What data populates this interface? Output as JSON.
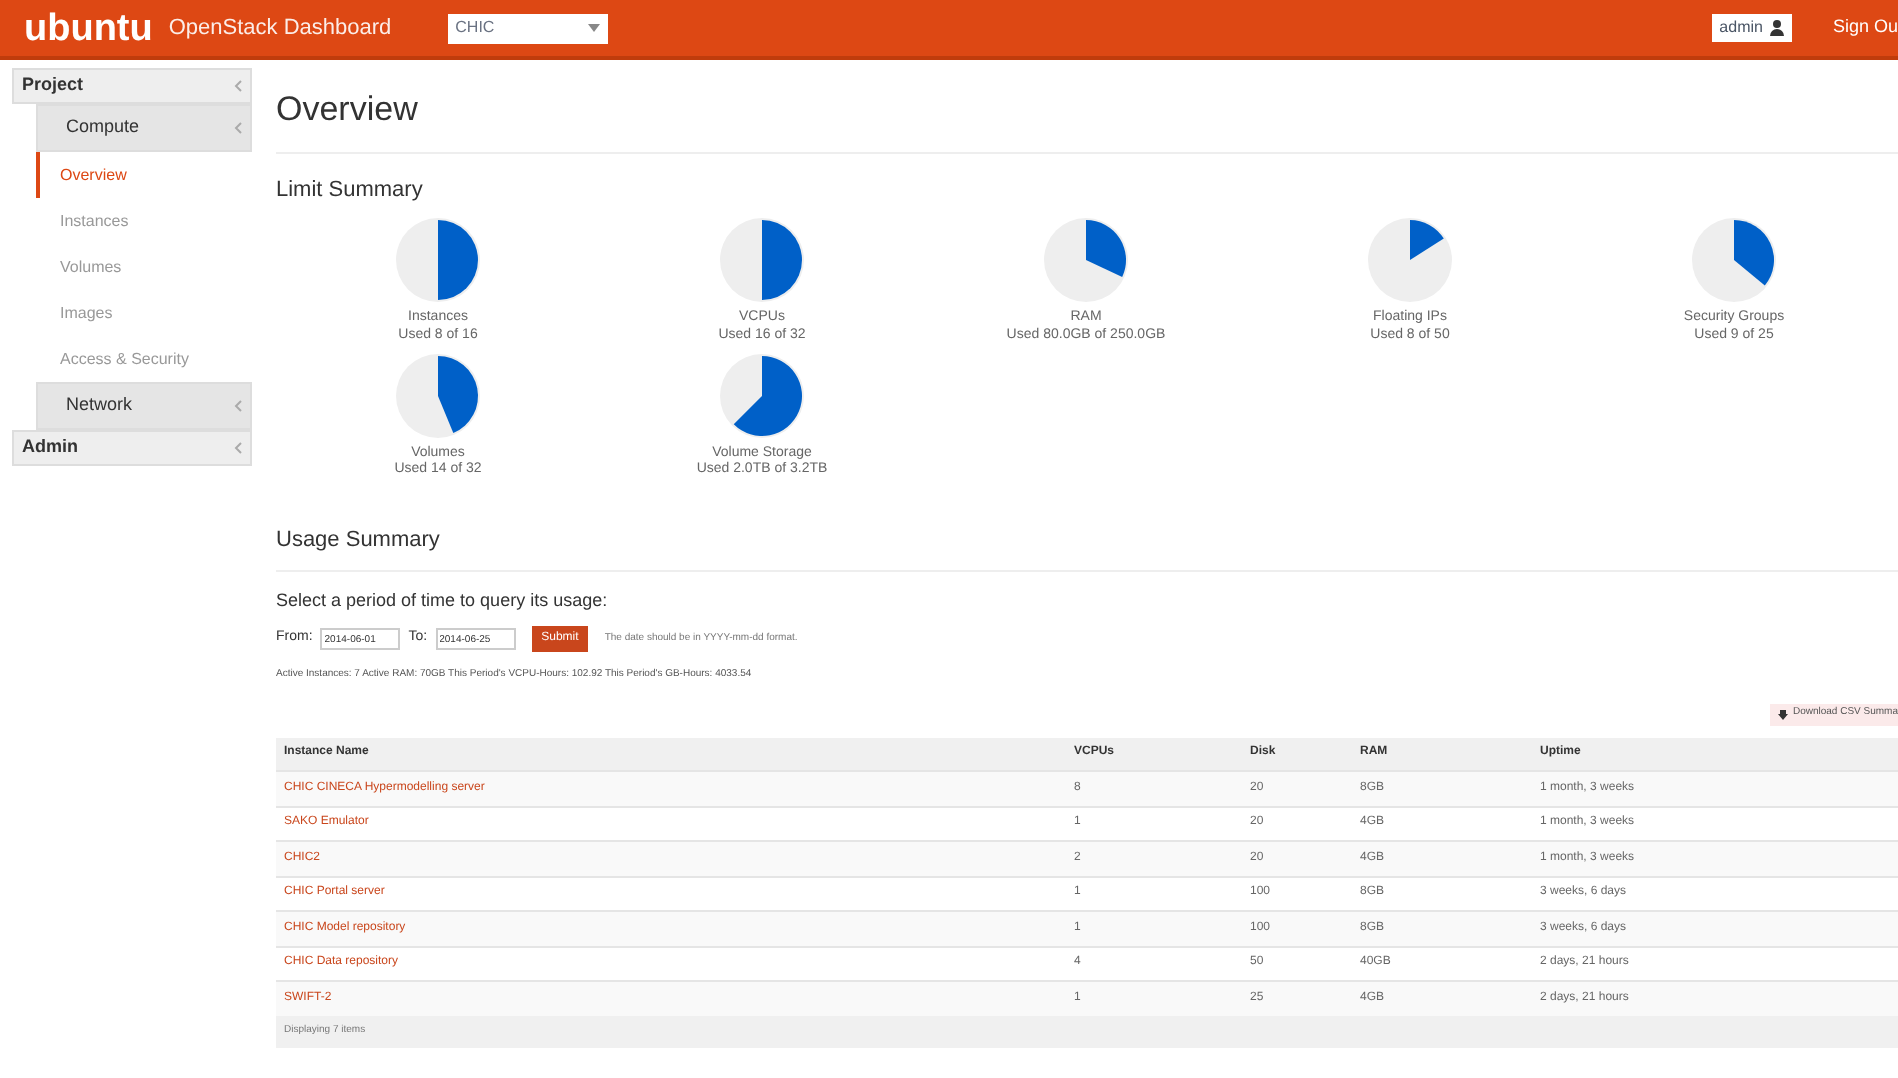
{
  "topbar": {
    "logo": "ubuntu",
    "product": "OpenStack Dashboard",
    "project_select": "CHIC",
    "user_menu": "admin",
    "sign_out": "Sign Ou"
  },
  "sidebar": {
    "items": [
      {
        "label": "Project",
        "kind": "section",
        "children": [
          {
            "label": "Compute",
            "kind": "group",
            "children": [
              {
                "label": "Overview",
                "kind": "link",
                "selected": true
              },
              {
                "label": "Instances",
                "kind": "link",
                "selected": false
              },
              {
                "label": "Volumes",
                "kind": "link",
                "selected": false
              },
              {
                "label": "Images",
                "kind": "link",
                "selected": false
              },
              {
                "label": "Access & Security",
                "kind": "link",
                "selected": false
              }
            ]
          },
          {
            "label": "Network",
            "kind": "group"
          }
        ]
      },
      {
        "label": "Admin",
        "kind": "section"
      }
    ]
  },
  "page_title": "Overview",
  "limit_summary": {
    "title": "Limit Summary",
    "pies": [
      {
        "name": "Instances",
        "reading": "Used 8 of 16"
      },
      {
        "name": "VCPUs",
        "reading": "Used 16 of 32"
      },
      {
        "name": "RAM",
        "reading": "Used 80.0GB of 250.0GB"
      },
      {
        "name": "Floating IPs",
        "reading": "Used 8 of 50"
      },
      {
        "name": "Security Groups",
        "reading": "Used 9 of 25"
      },
      {
        "name": "Volumes",
        "reading": "Used 14 of 32"
      },
      {
        "name": "Volume Storage",
        "reading": "Used 2.0TB of 3.2TB"
      }
    ]
  },
  "usage_summary": {
    "title": "Usage Summary",
    "prompt": "Select a period of time to query its usage:",
    "from_label": "From:",
    "from_value": "2014-06-01",
    "to_label": "To:",
    "to_value": "2014-06-25",
    "submit": "Submit",
    "hint": "The date should be in YYYY-mm-dd format.",
    "totals": "Active Instances: 7 Active RAM: 70GB This Period's VCPU-Hours: 102.92 This Period's GB-Hours: 4033.54",
    "download": "Download CSV Summa"
  },
  "table": {
    "columns": [
      "Instance Name",
      "VCPUs",
      "Disk",
      "RAM",
      "Uptime"
    ],
    "rows": [
      [
        "CHIC CINECA Hypermodelling server",
        "8",
        "20",
        "8GB",
        "1 month, 3 weeks"
      ],
      [
        "SAKO Emulator",
        "1",
        "20",
        "4GB",
        "1 month, 3 weeks"
      ],
      [
        "CHIC2",
        "2",
        "20",
        "4GB",
        "1 month, 3 weeks"
      ],
      [
        "CHIC Portal server",
        "1",
        "100",
        "8GB",
        "3 weeks, 6 days"
      ],
      [
        "CHIC Model repository",
        "1",
        "100",
        "8GB",
        "3 weeks, 6 days"
      ],
      [
        "CHIC Data repository",
        "4",
        "50",
        "40GB",
        "2 days, 21 hours"
      ],
      [
        "SWIFT-2",
        "1",
        "25",
        "4GB",
        "2 days, 21 hours"
      ]
    ],
    "footer": "Displaying 7 items"
  }
}
